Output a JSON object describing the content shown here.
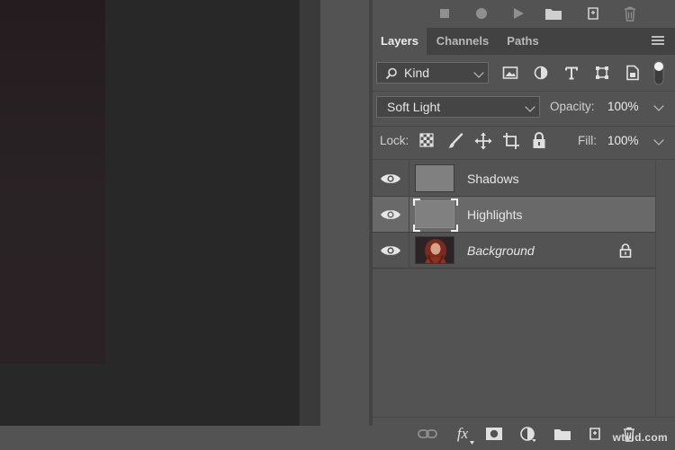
{
  "tabs": [
    {
      "label": "Layers"
    },
    {
      "label": "Channels"
    },
    {
      "label": "Paths"
    }
  ],
  "filter": {
    "kind_label": "Kind"
  },
  "blend": {
    "mode": "Soft Light",
    "opacity_label": "Opacity:",
    "opacity_value": "100%"
  },
  "lock": {
    "label": "Lock:",
    "fill_label": "Fill:",
    "fill_value": "100%"
  },
  "layers": [
    {
      "name": "Shadows"
    },
    {
      "name": "Highlights"
    },
    {
      "name": "Background"
    }
  ],
  "bottom_toolbar": {
    "fx_label": "fx"
  },
  "watermark": "wtvid.com",
  "colors": {
    "panel_bg": "#535353",
    "selected_row": "#696969",
    "tab_bar": "#424242",
    "canvas_bg": "#282828"
  }
}
